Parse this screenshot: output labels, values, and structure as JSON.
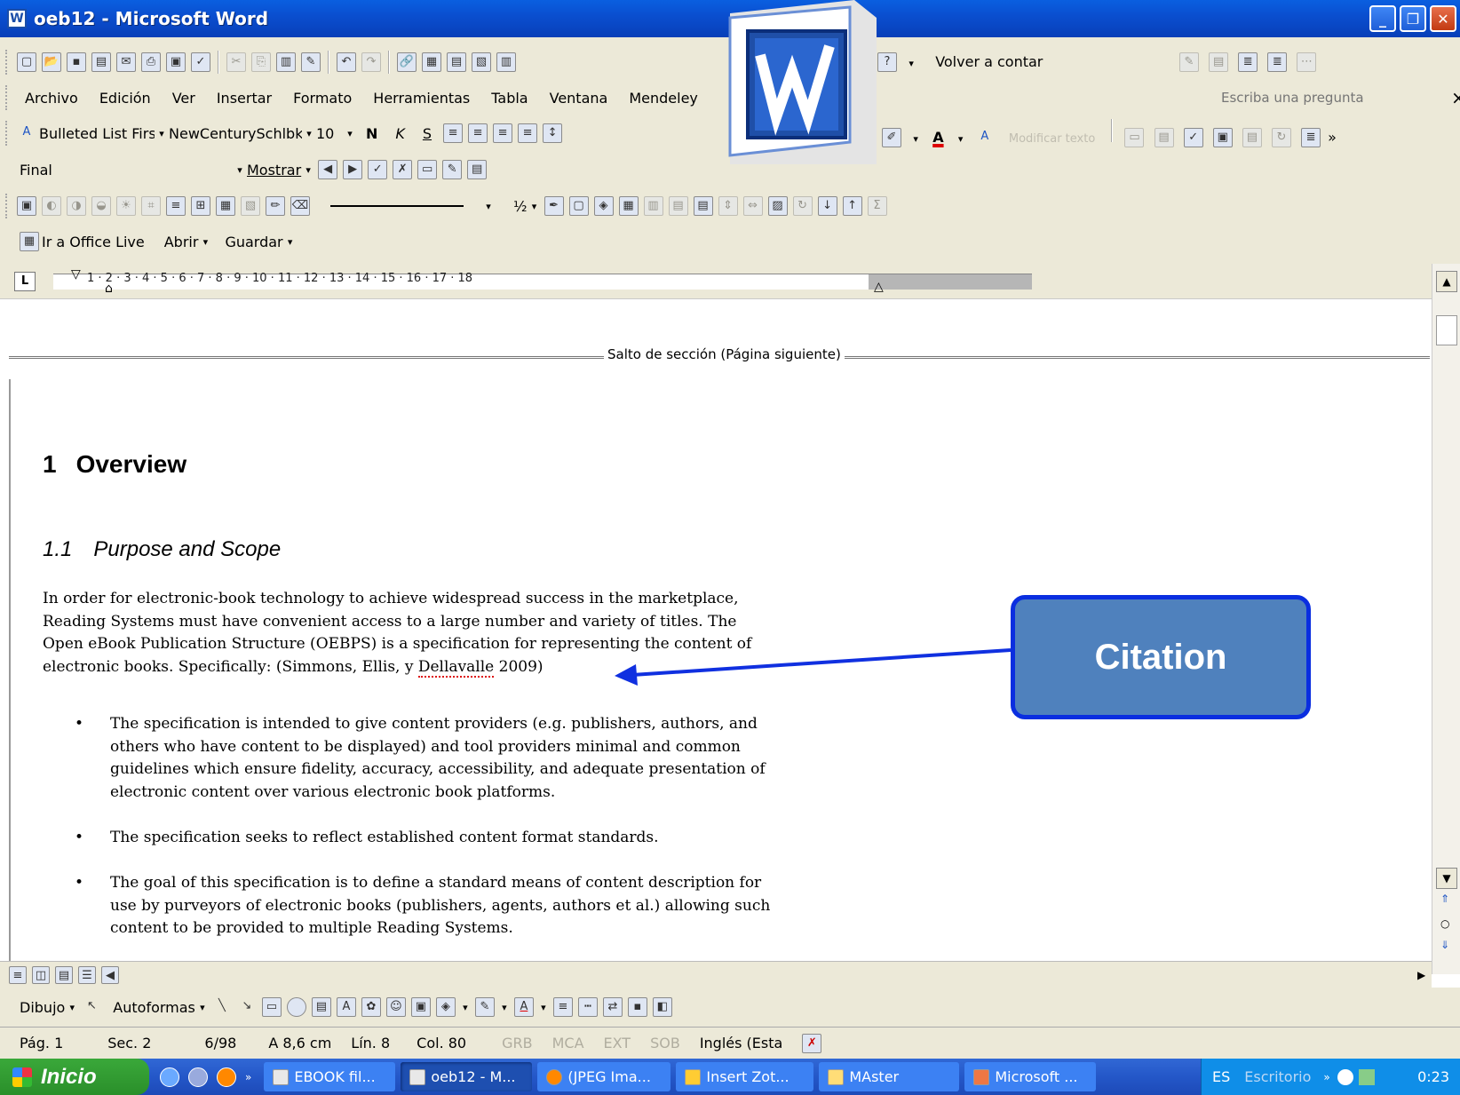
{
  "window": {
    "title": "oeb12 - Microsoft Word",
    "app_icon_letter": "W"
  },
  "window_buttons": {
    "minimize": "_",
    "maximize": "❐",
    "close": "✕"
  },
  "standard_toolbar": {
    "icons": [
      "new-doc",
      "open",
      "save",
      "permission",
      "email",
      "print",
      "print-preview",
      "spelling",
      "cut",
      "copy",
      "paste",
      "format-painter",
      "undo",
      "redo",
      "hyperlink",
      "tables-borders",
      "insert-table",
      "insert-excel",
      "columns"
    ],
    "help_icon": "?",
    "reading_label": "Volver a contar"
  },
  "menu": {
    "items": [
      "Archivo",
      "Edición",
      "Ver",
      "Insertar",
      "Formato",
      "Herramientas",
      "Tabla",
      "Ventana",
      "Mendeley"
    ],
    "ask_placeholder": "Escriba una pregunta",
    "close_doc": "×"
  },
  "formatting_toolbar": {
    "style": "Bulleted List Firs",
    "font": "NewCenturySchlbk",
    "size": "10",
    "bold": "N",
    "italic": "K",
    "underline": "S",
    "font_color_letter": "A",
    "more": "»",
    "faded_label": "Modificar texto"
  },
  "reviewing_toolbar": {
    "display": "Final",
    "show_label": "Mostrar"
  },
  "drawing_row": {
    "line_weight": "½"
  },
  "office_live": {
    "goto": "Ir a Office Live",
    "open": "Abrir",
    "save": "Guardar"
  },
  "ruler": {
    "tab_selector": "L",
    "ticks": "1 · 2 · 3 · 4 · 5 · 6 · 7 · 8 · 9 · 10 · 11 · 12 · 13 · 14 · 15 · 16 · 17 · 18"
  },
  "document": {
    "section_break": "Salto de sección (Página siguiente)",
    "heading1": {
      "number": "1",
      "text": "Overview"
    },
    "heading2": {
      "number": "1.1",
      "text": "Purpose and Scope"
    },
    "paragraph_lines": [
      "In order for electronic-book technology to achieve widespread success in the marketplace,",
      "Reading Systems must have convenient access to a large number and variety of titles.  The",
      "Open eBook Publication Structure (OEBPS) is a specification for representing the content of"
    ],
    "paragraph_last": {
      "before": "electronic books. Specifically: ",
      "citation_a": "(Simmons, Ellis, y ",
      "citation_squiggle": "Dellavalle",
      "citation_b": " 2009)"
    },
    "bullets": [
      {
        "symbol": "•",
        "lines": [
          "The specification is intended to give content providers (e.g. publishers, authors, and",
          "others who have content to be displayed) and tool providers minimal and common",
          "guidelines which ensure fidelity, accuracy, accessibility, and adequate presentation of",
          "electronic content over various electronic book platforms."
        ]
      },
      {
        "symbol": "•",
        "lines": [
          "The specification seeks to reflect established content format standards."
        ]
      },
      {
        "symbol": "•",
        "lines": [
          "The goal of this specification is to define a standard means of content description for",
          "use by purveyors of electronic books (publishers, agents, authors et al.) allowing such",
          "content to be provided to multiple Reading Systems."
        ]
      }
    ]
  },
  "callout": {
    "label": "Citation",
    "fill": "#4f81bd",
    "border": "#0a2ee0"
  },
  "draw_toolbar": {
    "draw": "Dibujo",
    "autoshapes": "Autoformas"
  },
  "status": {
    "page": "Pág. 1",
    "section": "Sec. 2",
    "pages": "6/98",
    "at": "A 8,6 cm",
    "line": "Lín. 8",
    "col": "Col. 80",
    "grb": "GRB",
    "mca": "MCA",
    "ext": "EXT",
    "sob": "SOB",
    "language": "Inglés (Esta"
  },
  "taskbar": {
    "start": "Inicio",
    "buttons": [
      "EBOOK fil...",
      "oeb12 - M...",
      "(JPEG Ima...",
      "Insert Zot...",
      "MAster",
      "Microsoft ..."
    ],
    "active_index": 1,
    "lang": "ES",
    "desktop": "Escritorio",
    "clock": "0:23"
  }
}
